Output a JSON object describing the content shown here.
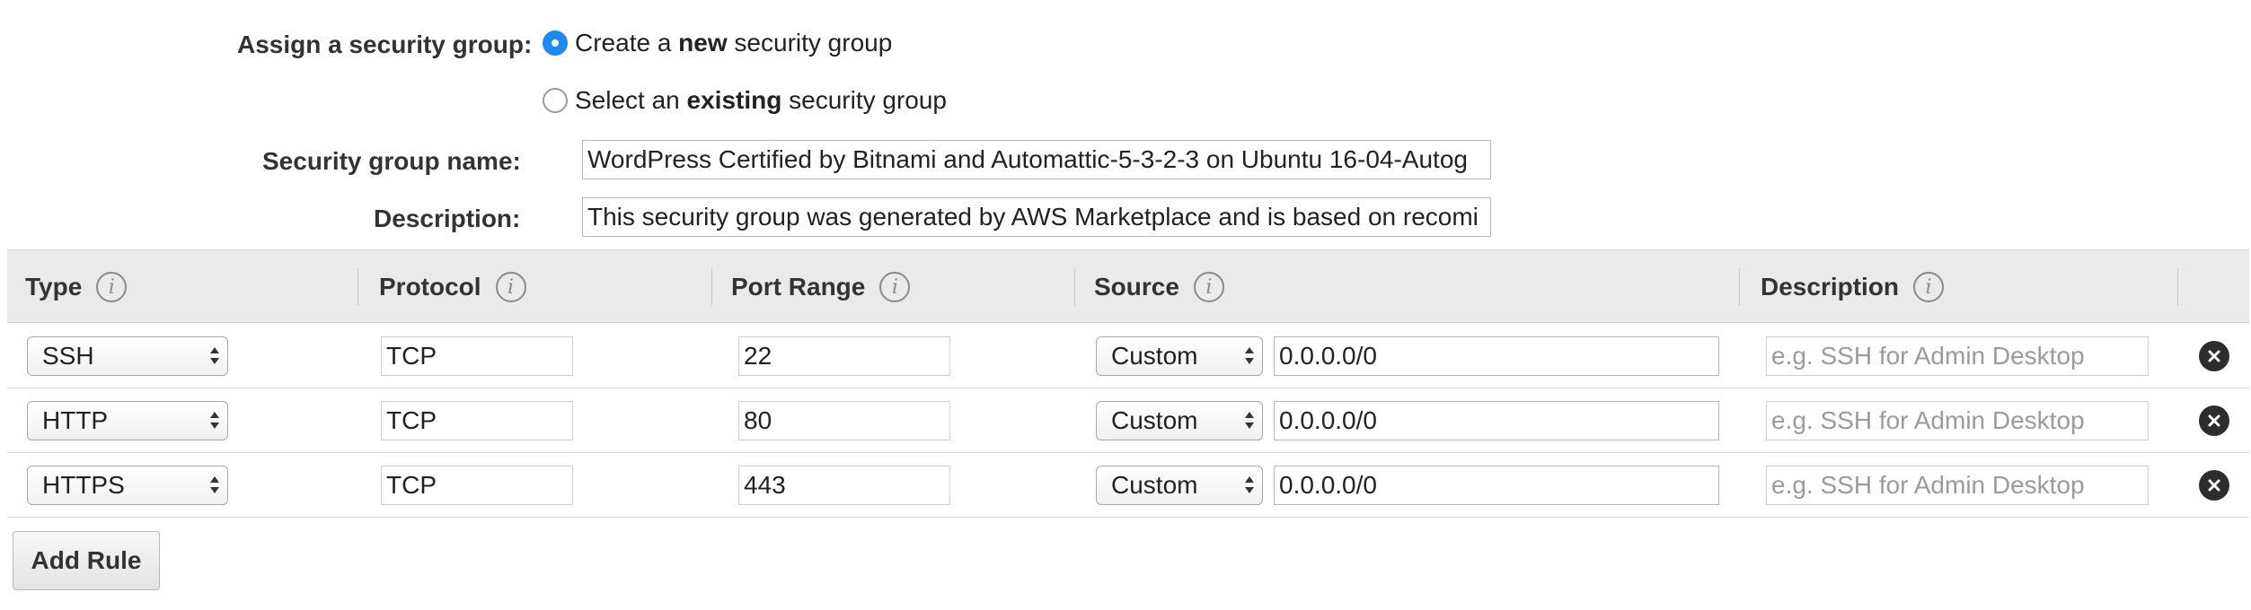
{
  "security_group": {
    "assign_label": "Assign a security group:",
    "option_new": {
      "pre": "Create a ",
      "bold": "new",
      "post": " security group",
      "selected": true
    },
    "option_existing": {
      "pre": "Select an ",
      "bold": "existing",
      "post": " security group",
      "selected": false
    },
    "name_label": "Security group name:",
    "name_value": "WordPress Certified by Bitnami and Automattic-5-3-2-3 on Ubuntu 16-04-Autog",
    "description_label": "Description:",
    "description_value": "This security group was generated by AWS Marketplace and is based on recomi"
  },
  "table": {
    "headers": {
      "type": "Type",
      "protocol": "Protocol",
      "port_range": "Port Range",
      "source": "Source",
      "description": "Description"
    },
    "info_icon": "info-icon",
    "rows": [
      {
        "type": "SSH",
        "protocol": "TCP",
        "port": "22",
        "source_mode": "Custom",
        "source_cidr": "0.0.0.0/0",
        "description_placeholder": "e.g. SSH for Admin Desktop"
      },
      {
        "type": "HTTP",
        "protocol": "TCP",
        "port": "80",
        "source_mode": "Custom",
        "source_cidr": "0.0.0.0/0",
        "description_placeholder": "e.g. SSH for Admin Desktop"
      },
      {
        "type": "HTTPS",
        "protocol": "TCP",
        "port": "443",
        "source_mode": "Custom",
        "source_cidr": "0.0.0.0/0",
        "description_placeholder": "e.g. SSH for Admin Desktop"
      }
    ]
  },
  "add_rule_label": "Add Rule",
  "colors": {
    "radio_selected": "#1e88f3",
    "header_bg": "#eaeaea",
    "delete_icon": "#2d2d2d"
  }
}
